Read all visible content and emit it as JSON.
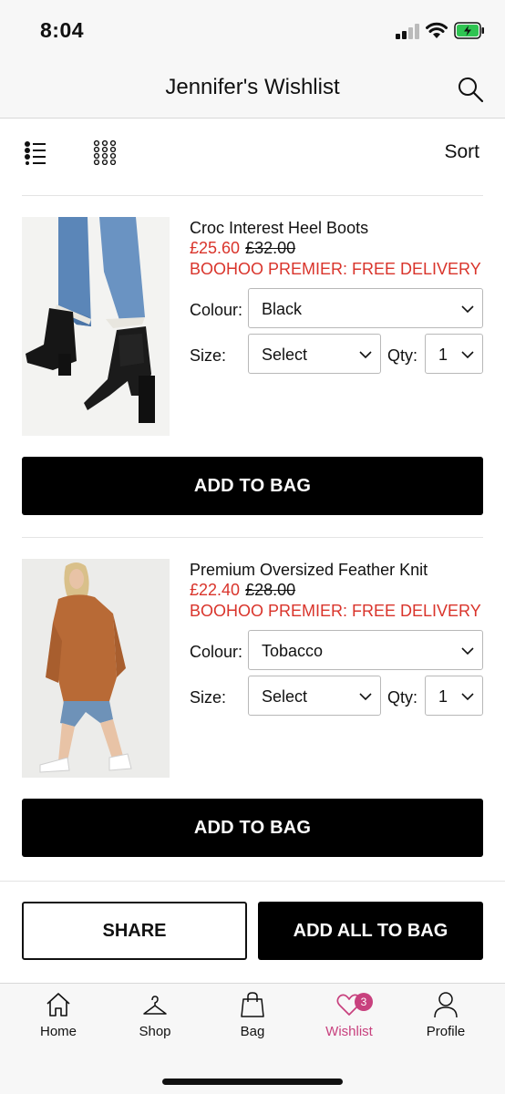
{
  "status_bar": {
    "time": "8:04"
  },
  "header": {
    "title": "Jennifer's Wishlist"
  },
  "toolbar": {
    "sort_label": "Sort"
  },
  "items": [
    {
      "name": "Croc Interest Heel Boots",
      "price": "£25.60",
      "was_price": "£32.00",
      "promo": "BOOHOO PREMIER: FREE DELIVERY",
      "colour_label": "Colour:",
      "colour_value": "Black",
      "size_label": "Size:",
      "size_value": "Select",
      "qty_label": "Qty:",
      "qty_value": "1",
      "add_button": "ADD TO BAG"
    },
    {
      "name": "Premium Oversized Feather Knit",
      "price": "£22.40",
      "was_price": "£28.00",
      "promo": "BOOHOO PREMIER: FREE DELIVERY",
      "colour_label": "Colour:",
      "colour_value": "Tobacco",
      "size_label": "Size:",
      "size_value": "Select",
      "qty_label": "Qty:",
      "qty_value": "1",
      "add_button": "ADD TO BAG"
    }
  ],
  "actions": {
    "share": "SHARE",
    "add_all": "ADD ALL TO BAG"
  },
  "tabs": [
    {
      "label": "Home",
      "icon": "home-icon"
    },
    {
      "label": "Shop",
      "icon": "hanger-icon"
    },
    {
      "label": "Bag",
      "icon": "bag-icon"
    },
    {
      "label": "Wishlist",
      "icon": "heart-icon",
      "badge": "3",
      "active": true
    },
    {
      "label": "Profile",
      "icon": "person-icon"
    }
  ],
  "colors": {
    "accent_red": "#d9342b",
    "wishlist_pink": "#c8417e",
    "button_black": "#000000"
  }
}
